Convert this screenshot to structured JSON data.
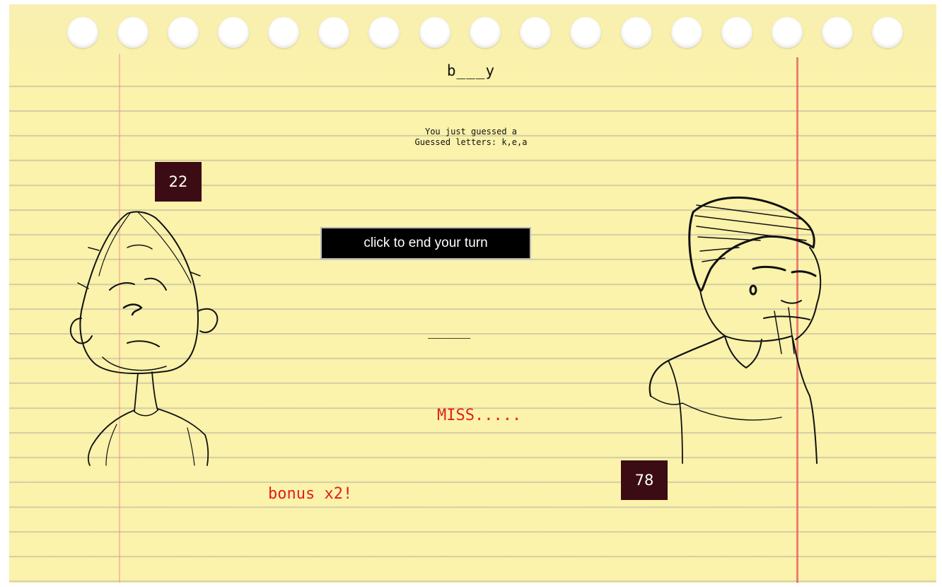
{
  "puzzle": {
    "word_display": "b___y",
    "last_guess_text": "You just guessed a",
    "guessed_letters_text": "Guessed letters: k,e,a",
    "blank_display": "_____"
  },
  "players": {
    "left": {
      "score": "22",
      "avatar_icon": "bald-kid-sketch-icon"
    },
    "right": {
      "score": "78",
      "avatar_icon": "spiky-hair-guy-sketch-icon"
    }
  },
  "controls": {
    "end_turn_label": "click to end your turn"
  },
  "feedback": {
    "result_text": "MISS.....",
    "bonus_text": "bonus x2!"
  },
  "colors": {
    "paper": "#fbf2ab",
    "score_box": "#3c0c14",
    "feedback_text": "#e0201a",
    "margin_line": "#e65a5a"
  }
}
